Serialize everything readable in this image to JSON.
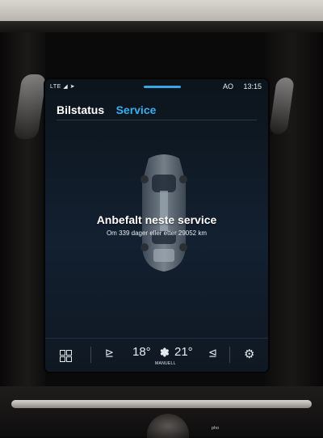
{
  "status_bar": {
    "signal": "LTE",
    "indicator": "AO",
    "time": "13:15"
  },
  "tabs": [
    {
      "label": "Bilstatus",
      "active": false
    },
    {
      "label": "Service",
      "active": true
    }
  ],
  "service": {
    "title": "Anbefalt neste service",
    "detail": "Om 339 dager eller etter 29052 km"
  },
  "climate": {
    "temp_left": "18°",
    "fan_label": "MANUELL",
    "temp_right": "21°"
  },
  "icons": [
    "apps-grid-icon",
    "heated-seat-left-icon",
    "fan-icon",
    "heated-seat-right-icon",
    "settings-gear-icon"
  ],
  "colors": {
    "accent": "#39aef0",
    "screen_background": "#132030"
  }
}
